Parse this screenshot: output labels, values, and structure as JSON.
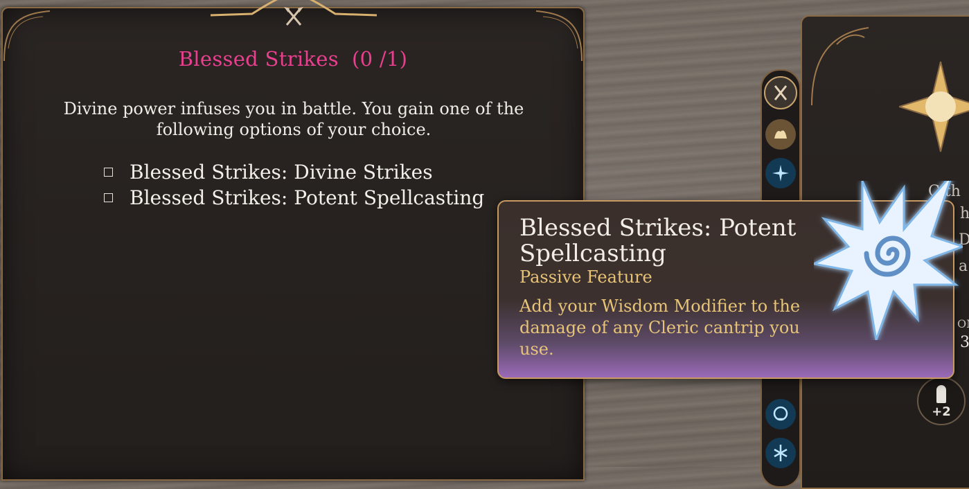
{
  "feature_panel": {
    "title": "Blessed Strikes",
    "count": "(0 /1)",
    "description": "Divine power infuses you in battle. You gain one of the following options of your choice.",
    "options": [
      {
        "label": "Blessed Strikes: Divine Strikes",
        "checked": false
      },
      {
        "label": "Blessed Strikes: Potent Spellcasting",
        "checked": false
      }
    ]
  },
  "tooltip": {
    "title": "Blessed Strikes: Potent Spellcasting",
    "subtitle": "Passive Feature",
    "body": "Add your Wisdom Modifier to the damage of any Cleric cantrip you use.",
    "icon": "spiral-burst-icon"
  },
  "rail": {
    "icons": [
      "crossed-axes-icon",
      "strength-icon",
      "sparkles-icon",
      "skull-icon",
      "rune-icon"
    ]
  },
  "character_panel": {
    "partial_text_1": "Cith",
    "partial_text_2": "h",
    "partial_text_3": "D",
    "partial_text_4": "a",
    "partial_text_5": "ON",
    "partial_text_6": "3",
    "bonus": "+2"
  },
  "colors": {
    "title_pink": "#e8408e",
    "gold_text": "#e7c477",
    "frame_gold": "#8a6a45"
  }
}
